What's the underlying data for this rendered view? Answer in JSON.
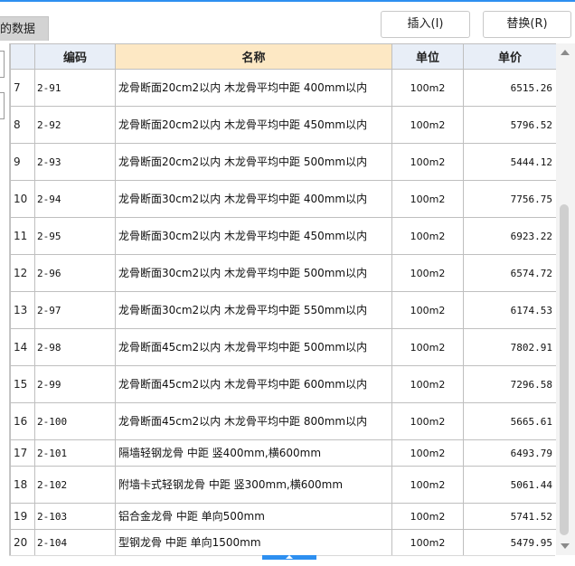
{
  "tab": {
    "label": "的数据"
  },
  "toolbar": {
    "insert_label": "插入(I)",
    "replace_label": "替换(R)"
  },
  "table": {
    "headers": {
      "index": "",
      "code": "编码",
      "name": "名称",
      "unit": "单位",
      "price": "单价"
    },
    "rows": [
      {
        "index": "7",
        "code": "2-91",
        "name": "龙骨断面20cm2以内 木龙骨平均中距 400mm以内",
        "unit": "100m2",
        "price": "6515.26"
      },
      {
        "index": "8",
        "code": "2-92",
        "name": "龙骨断面20cm2以内 木龙骨平均中距 450mm以内",
        "unit": "100m2",
        "price": "5796.52"
      },
      {
        "index": "9",
        "code": "2-93",
        "name": "龙骨断面20cm2以内 木龙骨平均中距 500mm以内",
        "unit": "100m2",
        "price": "5444.12"
      },
      {
        "index": "10",
        "code": "2-94",
        "name": "龙骨断面30cm2以内 木龙骨平均中距 400mm以内",
        "unit": "100m2",
        "price": "7756.75"
      },
      {
        "index": "11",
        "code": "2-95",
        "name": "龙骨断面30cm2以内 木龙骨平均中距 450mm以内",
        "unit": "100m2",
        "price": "6923.22"
      },
      {
        "index": "12",
        "code": "2-96",
        "name": "龙骨断面30cm2以内 木龙骨平均中距 500mm以内",
        "unit": "100m2",
        "price": "6574.72"
      },
      {
        "index": "13",
        "code": "2-97",
        "name": "龙骨断面30cm2以内 木龙骨平均中距 550mm以内",
        "unit": "100m2",
        "price": "6174.53"
      },
      {
        "index": "14",
        "code": "2-98",
        "name": "龙骨断面45cm2以内 木龙骨平均中距 500mm以内",
        "unit": "100m2",
        "price": "7802.91"
      },
      {
        "index": "15",
        "code": "2-99",
        "name": "龙骨断面45cm2以内 木龙骨平均中距 600mm以内",
        "unit": "100m2",
        "price": "7296.58"
      },
      {
        "index": "16",
        "code": "2-100",
        "name": "龙骨断面45cm2以内 木龙骨平均中距 800mm以内",
        "unit": "100m2",
        "price": "5665.61"
      },
      {
        "index": "17",
        "code": "2-101",
        "name": "隔墙轻钢龙骨 中距 竖400mm,横600mm",
        "unit": "100m2",
        "price": "6493.79"
      },
      {
        "index": "18",
        "code": "2-102",
        "name": "附墙卡式轻钢龙骨 中距 竖300mm,横600mm",
        "unit": "100m2",
        "price": "5061.44"
      },
      {
        "index": "19",
        "code": "2-103",
        "name": "铝合金龙骨 中距 单向500mm",
        "unit": "100m2",
        "price": "5741.52"
      },
      {
        "index": "20",
        "code": "2-104",
        "name": "型钢龙骨 中距 单向1500mm",
        "unit": "100m2",
        "price": "5479.95"
      }
    ]
  },
  "colors": {
    "accent": "#2d8ff0",
    "header_bg": "#e8eef7",
    "name_header_bg": "#fde8c4"
  }
}
